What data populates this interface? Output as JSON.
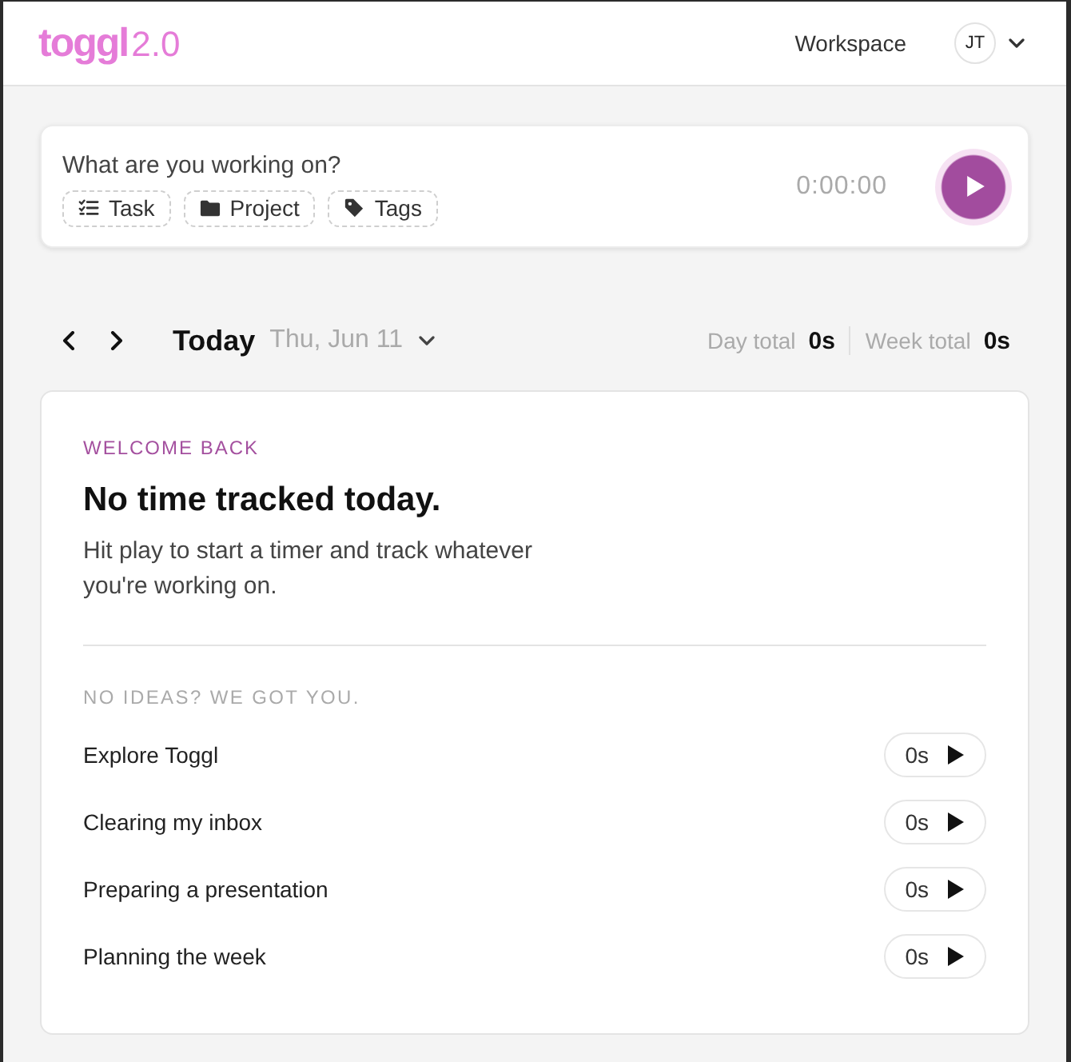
{
  "header": {
    "logo": "toggl",
    "version": "2.0",
    "workspace": "Workspace",
    "avatar_initials": "JT"
  },
  "timer": {
    "placeholder": "What are you working on?",
    "chips": [
      {
        "kind": "task",
        "label": "Task"
      },
      {
        "kind": "project",
        "label": "Project"
      },
      {
        "kind": "tags",
        "label": "Tags"
      }
    ],
    "elapsed": "0:00:00"
  },
  "date_bar": {
    "title": "Today",
    "date": "Thu, Jun 11",
    "totals": [
      {
        "label": "Day total",
        "value": "0s"
      },
      {
        "label": "Week total",
        "value": "0s"
      }
    ]
  },
  "welcome": {
    "eyebrow": "WELCOME BACK",
    "heading": "No time tracked today.",
    "body": "Hit play to start a timer and track whatever you're working on.",
    "suggestions_heading": "NO IDEAS? WE GOT YOU.",
    "suggestions": [
      {
        "label": "Explore Toggl",
        "duration": "0s"
      },
      {
        "label": "Clearing my inbox",
        "duration": "0s"
      },
      {
        "label": "Preparing a presentation",
        "duration": "0s"
      },
      {
        "label": "Planning the week",
        "duration": "0s"
      }
    ]
  }
}
